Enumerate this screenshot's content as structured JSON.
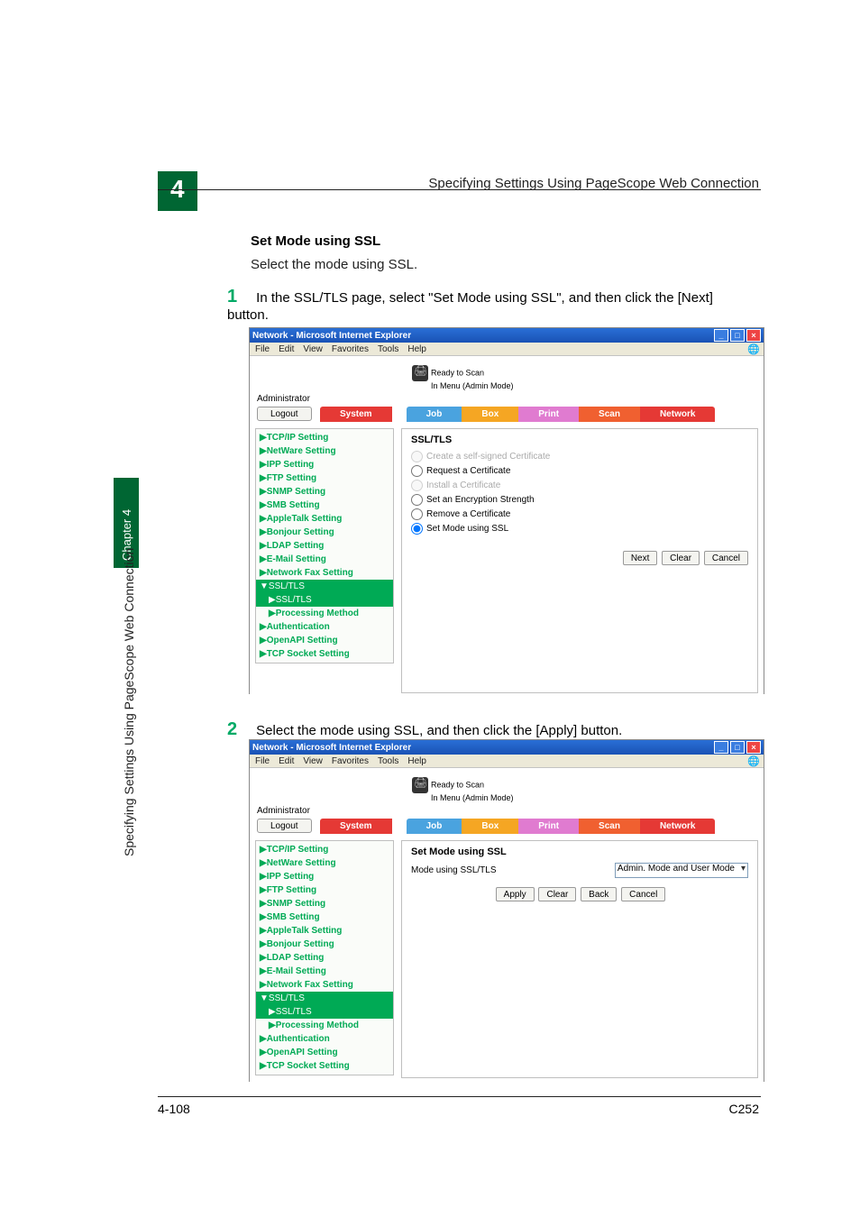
{
  "header": {
    "chapter_number": "4",
    "header_title": "Specifying Settings Using PageScope Web Connection"
  },
  "section": {
    "heading": "Set Mode using SSL",
    "intro": "Select the mode using SSL."
  },
  "steps": {
    "step1_num": "1",
    "step1_text": "In the SSL/TLS page, select \"Set Mode using SSL\", and then click the [Next] button.",
    "step2_num": "2",
    "step2_text": "Select the mode using SSL, and then click the [Apply] button."
  },
  "ie": {
    "title": "Network - Microsoft Internet Explorer",
    "menu": [
      "File",
      "Edit",
      "View",
      "Favorites",
      "Tools",
      "Help"
    ],
    "status1": "Ready to Scan",
    "status2": "In Menu (Admin Mode)",
    "admin": "Administrator",
    "logout": "Logout",
    "tabs": {
      "system": "System",
      "job": "Job",
      "box": "Box",
      "print": "Print",
      "scan": "Scan",
      "network": "Network"
    }
  },
  "sidebar_items": [
    "▶TCP/IP Setting",
    "▶NetWare Setting",
    "▶IPP Setting",
    "▶FTP Setting",
    "▶SNMP Setting",
    "▶SMB Setting",
    "▶AppleTalk Setting",
    "▶Bonjour Setting",
    "▶LDAP Setting",
    "▶E-Mail Setting",
    "▶Network Fax Setting"
  ],
  "sidebar_ssl_group": {
    "parent": "▼SSL/TLS",
    "child": "▶SSL/TLS",
    "method": "▶Processing Method"
  },
  "sidebar_bottom": [
    "▶Authentication",
    "▶OpenAPI Setting",
    "▶TCP Socket Setting"
  ],
  "panel1": {
    "title": "SSL/TLS",
    "opts": [
      "Create a self-signed Certificate",
      "Request a Certificate",
      "Install a Certificate",
      "Set an Encryption Strength",
      "Remove a Certificate",
      "Set Mode using SSL"
    ],
    "selected_index": 5,
    "disabled_indices": [
      0,
      2
    ],
    "btn_next": "Next",
    "btn_clear": "Clear",
    "btn_cancel": "Cancel"
  },
  "panel2": {
    "title": "Set Mode using SSL",
    "field_label": "Mode using SSL/TLS",
    "select_value": "Admin. Mode and User Mode",
    "btn_apply": "Apply",
    "btn_clear": "Clear",
    "btn_back": "Back",
    "btn_cancel": "Cancel"
  },
  "side_label": {
    "chapter": "Chapter 4",
    "vertical": "Specifying Settings Using PageScope Web Connection"
  },
  "footer": {
    "left": "4-108",
    "right": "C252"
  }
}
